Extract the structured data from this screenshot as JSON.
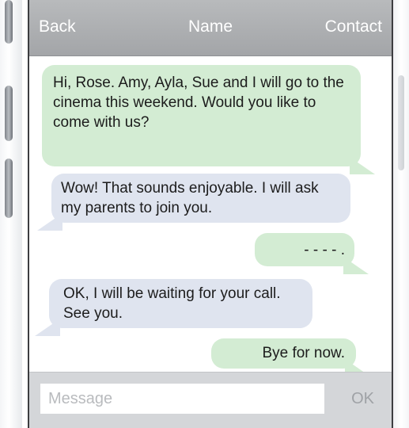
{
  "header": {
    "back_label": "Back",
    "title": "Name",
    "contact_label": "Contact"
  },
  "messages": [
    {
      "sender": "me",
      "text": "Hi, Rose. Amy, Ayla, Sue and I will go to the cinema this weekend. Would you like to come with us?"
    },
    {
      "sender": "them",
      "text": "Wow! That sounds enjoyable. I will ask my parents to join you."
    },
    {
      "sender": "me",
      "text": "- - - - ."
    },
    {
      "sender": "them",
      "text": "OK, I will be waiting for your call. See you."
    },
    {
      "sender": "me",
      "text": "Bye for now."
    }
  ],
  "composer": {
    "placeholder": "Message",
    "value": "",
    "send_label": "OK"
  },
  "colors": {
    "header_bg": "#a9abae",
    "outgoing_bubble": "#d3ecd3",
    "incoming_bubble": "#dfe4ef",
    "composer_bg": "#d4d6d9"
  }
}
